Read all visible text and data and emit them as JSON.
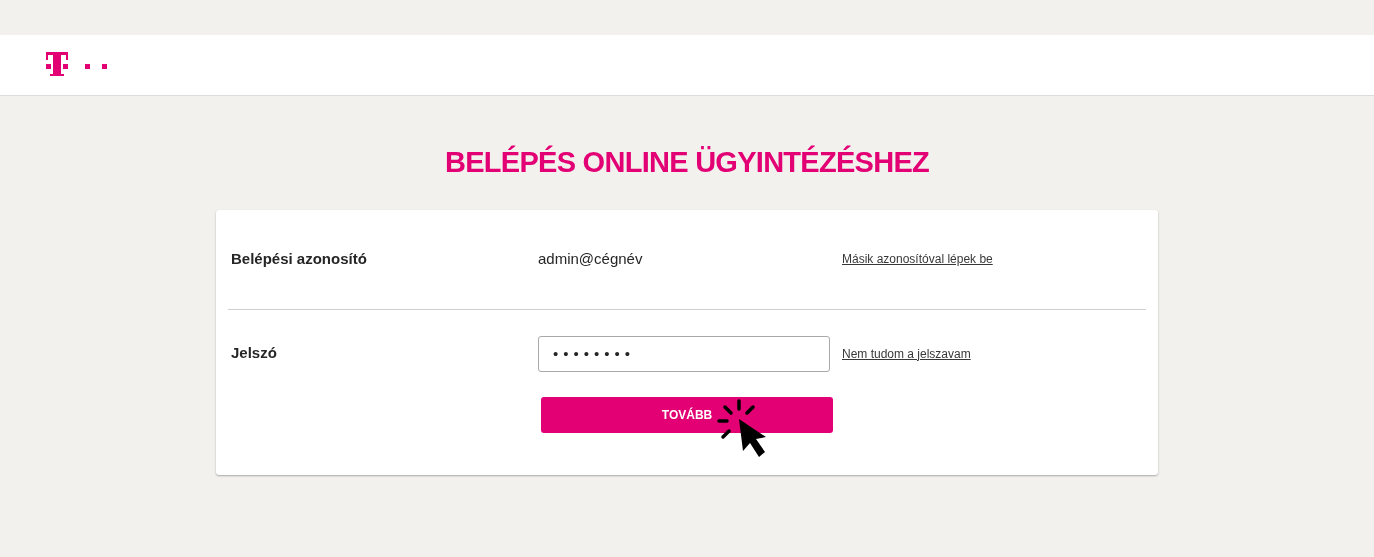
{
  "title": "BELÉPÉS ONLINE ÜGYINTÉZÉSHEZ",
  "login_id": {
    "label": "Belépési azonosító",
    "value": "admin@cégnév",
    "link": "Másik azonosítóval lépek be"
  },
  "password": {
    "label": "Jelszó",
    "value": "••••••••",
    "link": "Nem tudom a jelszavam"
  },
  "submit_button": "TOVÁBB"
}
